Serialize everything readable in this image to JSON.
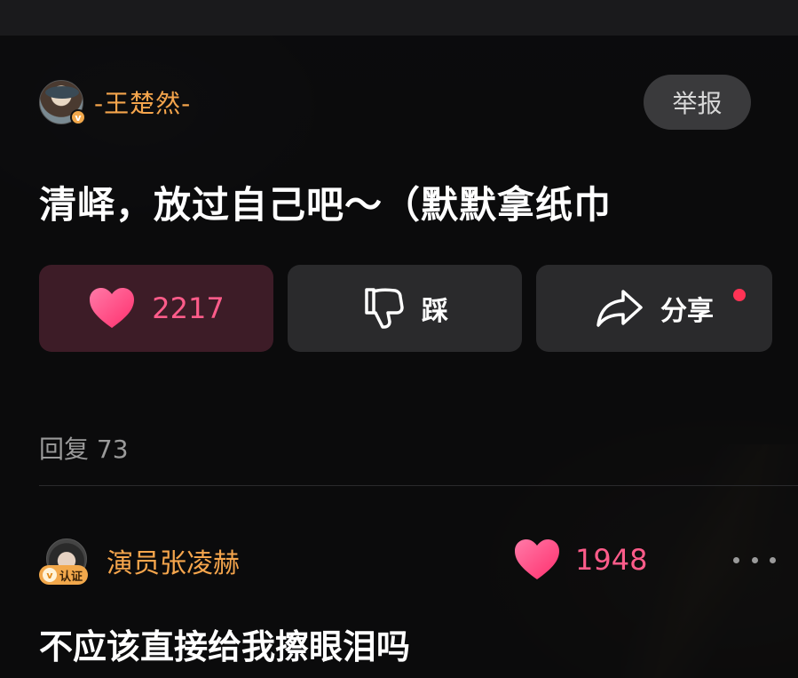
{
  "comment": {
    "author": "-王楚然-",
    "report_label": "举报",
    "text": "清峄，放过自己吧～（默默拿纸巾",
    "actions": {
      "like_count": "2217",
      "dislike_label": "踩",
      "share_label": "分享"
    },
    "reply_count_label": "回复 73"
  },
  "reply": {
    "author": "演员张凌赫",
    "verified_label": "认证",
    "like_count": "1948",
    "text": "不应该直接给我擦眼泪吗"
  },
  "colors": {
    "accent_gold": "#f5a54c",
    "like_pink": "#ff5c8a",
    "notify_dot": "#ff3355"
  },
  "icons": [
    "heart-icon",
    "thumbs-down-icon",
    "share-arrow-icon",
    "more-dots-icon",
    "verified-v-icon"
  ]
}
